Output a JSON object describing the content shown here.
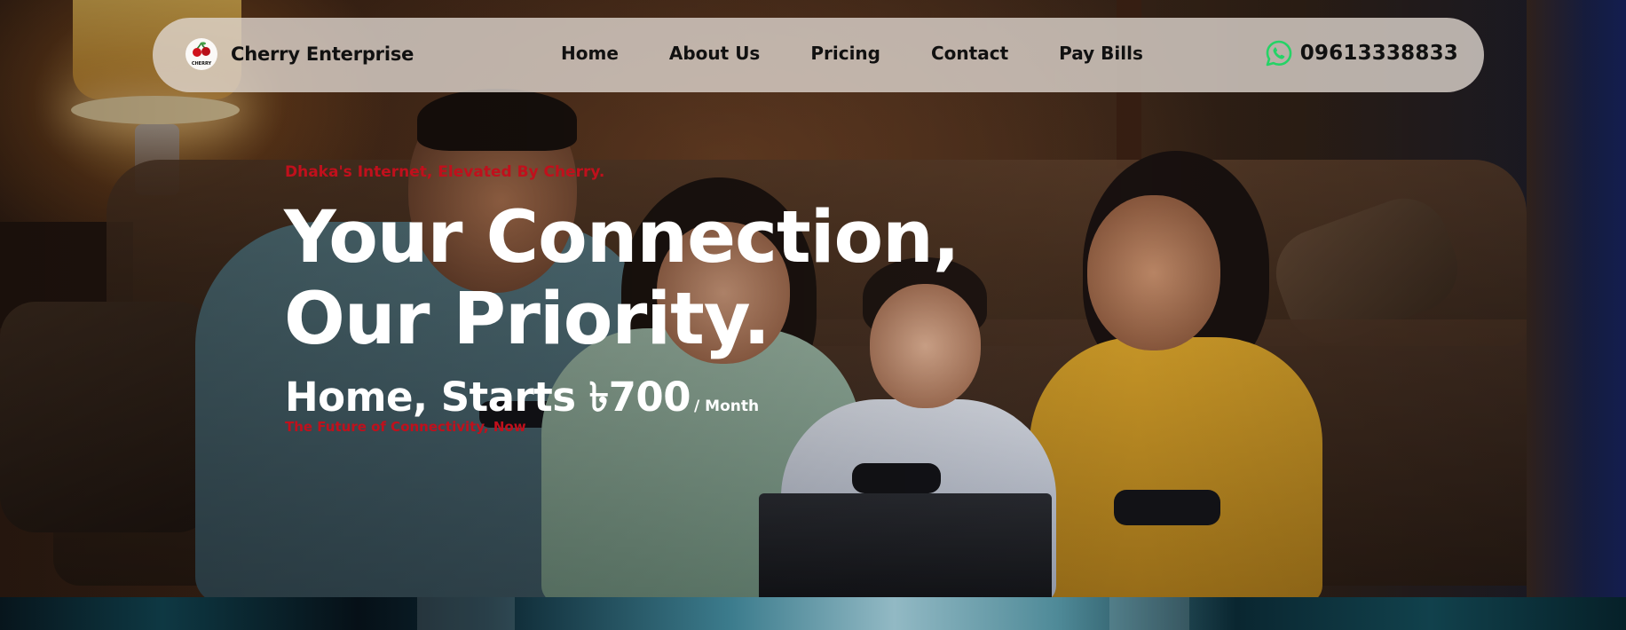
{
  "navbar": {
    "brand_name": "Cherry Enterprise",
    "logo_text": "CHERRY",
    "links": [
      {
        "label": "Home"
      },
      {
        "label": "About Us"
      },
      {
        "label": "Pricing"
      },
      {
        "label": "Contact"
      },
      {
        "label": "Pay Bills"
      }
    ],
    "phone": "09613338833",
    "phone_icon": "whatsapp-icon"
  },
  "hero": {
    "tagline": "Dhaka's Internet, Elevated By Cherry.",
    "headline_line1": "Your Connection,",
    "headline_line2": "Our Priority.",
    "price_main": "Home, Starts ৳700",
    "price_suffix": "/ Month",
    "subline": "The Future of Connectivity, Now"
  },
  "colors": {
    "accent_red": "#c0101c",
    "whatsapp_green": "#25D366",
    "navbar_bg": "#ded6ce",
    "headline_text": "#ffffff"
  }
}
